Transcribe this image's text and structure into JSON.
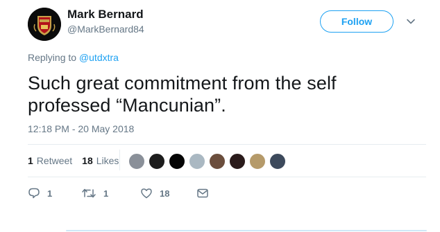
{
  "user": {
    "name": "Mark Bernard",
    "handle": "@MarkBernard84",
    "avatar_icon": "club-crest-avatar"
  },
  "follow_label": "Follow",
  "replying": {
    "prefix": "Replying to",
    "target": "@utdxtra"
  },
  "tweet": {
    "text_line1": "Such great commitment from the self",
    "text_line2": "professed “Mancunian”.",
    "timestamp": "12:18 PM - 20 May 2018"
  },
  "stats": {
    "retweets": "1",
    "retweets_label": "Retweet",
    "likes": "18",
    "likes_label": "Likes"
  },
  "likers": [
    {
      "icon": "liker-avatar-1",
      "color": "#8a9099"
    },
    {
      "icon": "liker-avatar-2",
      "color": "#1d1d1d"
    },
    {
      "icon": "liker-avatar-3",
      "color": "#050505"
    },
    {
      "icon": "liker-avatar-4",
      "color": "#aab8c2"
    },
    {
      "icon": "liker-avatar-5",
      "color": "#6b4e3d"
    },
    {
      "icon": "liker-avatar-6",
      "color": "#2a1b1b"
    },
    {
      "icon": "liker-avatar-7",
      "color": "#b59a6a"
    },
    {
      "icon": "liker-avatar-8",
      "color": "#3d4a5c"
    }
  ],
  "actions": {
    "reply_count": "1",
    "retweet_count": "1",
    "like_count": "18"
  },
  "colors": {
    "accent": "#1da1f2",
    "secondary_text": "#657786",
    "divider": "#e6ecf0"
  }
}
